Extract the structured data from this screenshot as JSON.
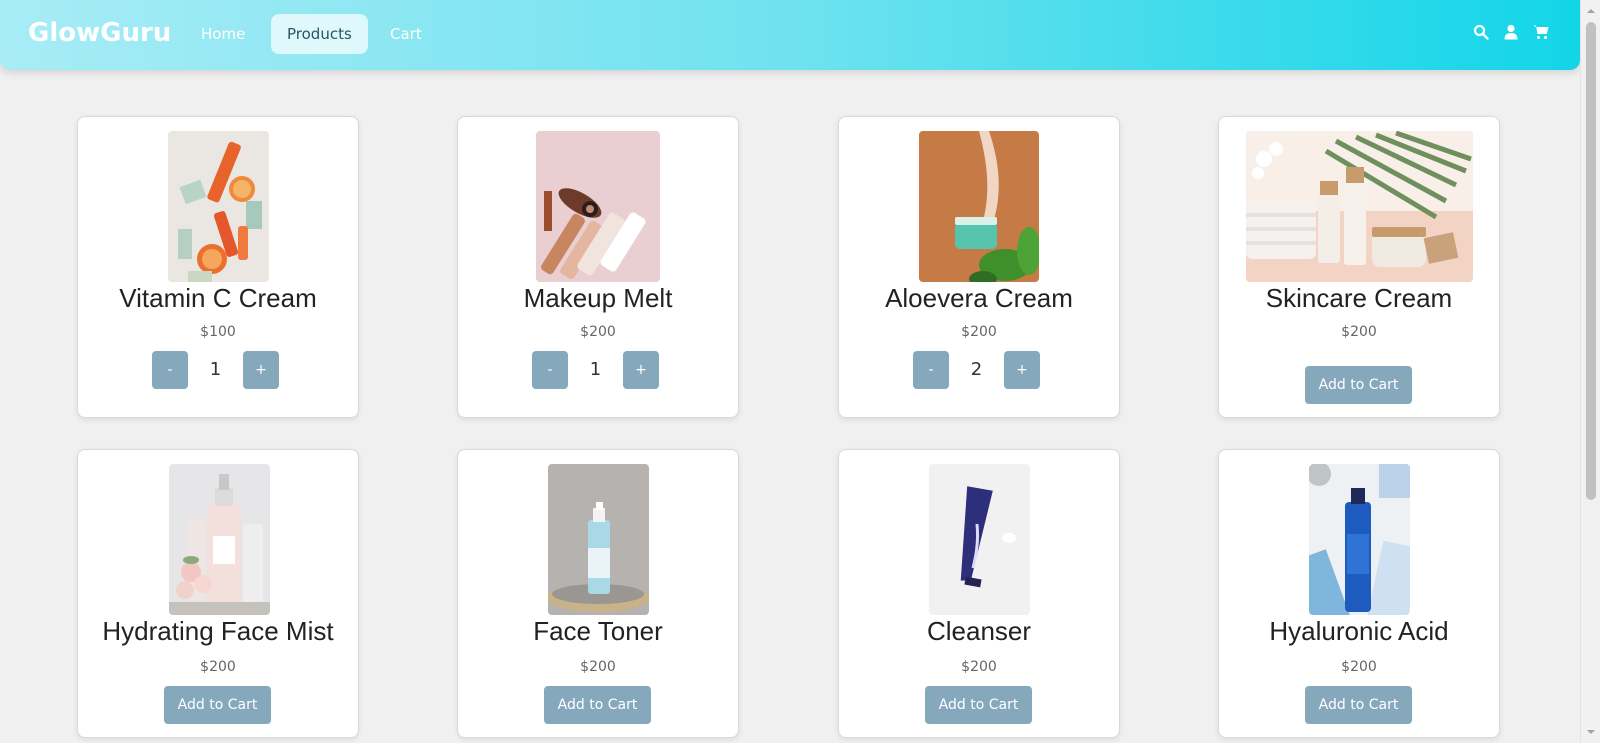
{
  "nav": {
    "brand": "GlowGuru",
    "links": [
      {
        "label": "Home",
        "active": false
      },
      {
        "label": "Products",
        "active": true
      },
      {
        "label": "Cart",
        "active": false
      }
    ],
    "icons": [
      "search-icon",
      "user-icon",
      "cart-icon"
    ]
  },
  "products": [
    {
      "name": "Vitamin C Cream",
      "price": "$100",
      "in_cart": true,
      "quantity": "1",
      "minus_label": "-",
      "plus_label": "+"
    },
    {
      "name": "Makeup Melt",
      "price": "$200",
      "in_cart": true,
      "quantity": "1",
      "minus_label": "-",
      "plus_label": "+"
    },
    {
      "name": "Aloevera Cream",
      "price": "$200",
      "in_cart": true,
      "quantity": "2",
      "minus_label": "-",
      "plus_label": "+"
    },
    {
      "name": "Skincare Cream",
      "price": "$200",
      "in_cart": false,
      "add_label": "Add to Cart"
    },
    {
      "name": "Hydrating Face Mist",
      "price": "$200",
      "in_cart": false,
      "add_label": "Add to Cart"
    },
    {
      "name": "Face Toner",
      "price": "$200",
      "in_cart": false,
      "add_label": "Add to Cart"
    },
    {
      "name": "Cleanser",
      "price": "$200",
      "in_cart": false,
      "add_label": "Add to Cart"
    },
    {
      "name": "Hyaluronic Acid",
      "price": "$200",
      "in_cart": false,
      "add_label": "Add to Cart"
    }
  ],
  "colors": {
    "nav_gradient_start": "#a8ecf6",
    "nav_gradient_end": "#12d5e8",
    "button": "#86a8bd",
    "page_bg": "#f0f0f0"
  }
}
